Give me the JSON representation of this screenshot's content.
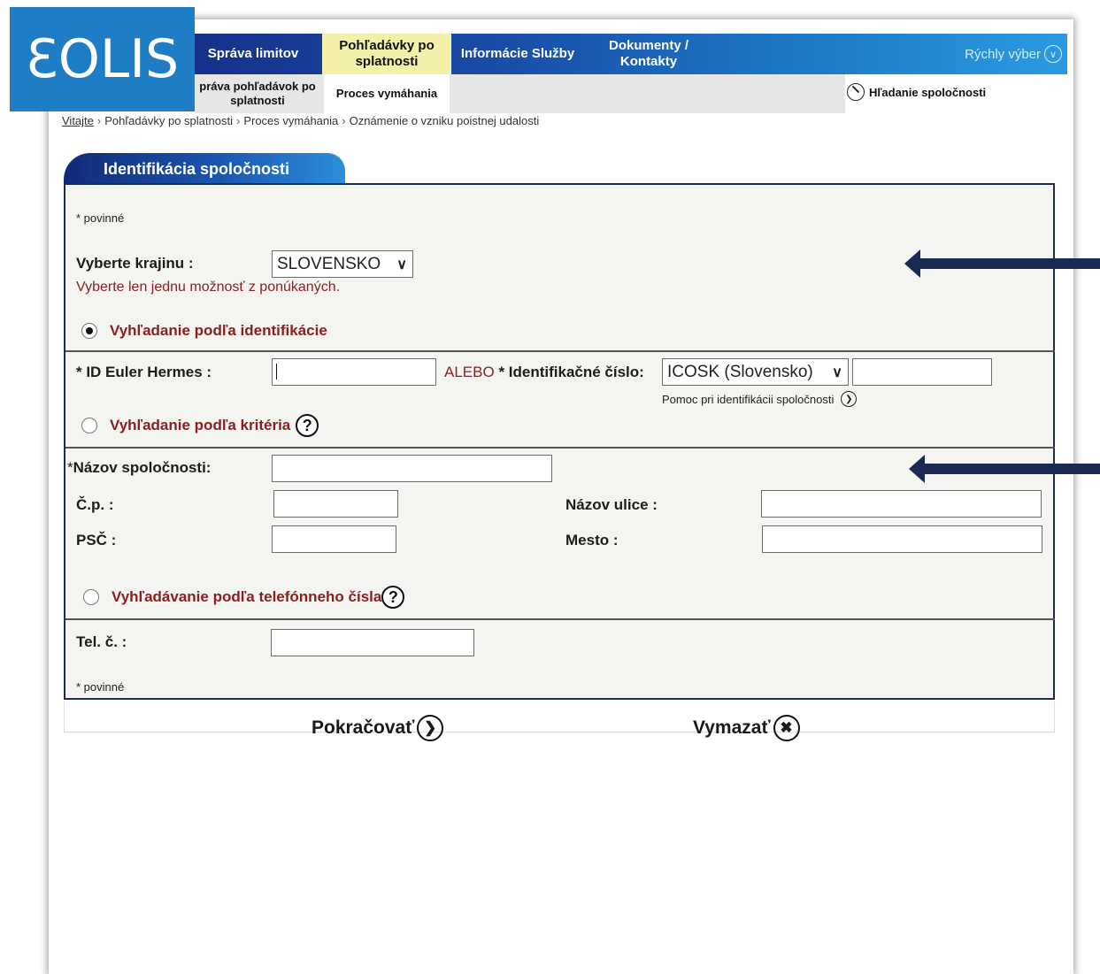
{
  "logo": {
    "text": "ƐOLIS"
  },
  "nav": {
    "items": [
      {
        "label": "Správa limitov"
      },
      {
        "label": "Pohľadávky po splatnosti"
      },
      {
        "label": "Informácie Služby"
      },
      {
        "label": "Dokumenty / Kontakty"
      }
    ],
    "quick": "Rýchly výber"
  },
  "subnav": {
    "items": [
      {
        "label": "práva pohľadávok po splatnosti"
      },
      {
        "label": "Proces vymáhania"
      }
    ],
    "company_search": "Hľadanie  spoločnosti"
  },
  "breadcrumb": {
    "home": "Vitajte",
    "items": [
      "Pohľadávky po splatnosti",
      "Proces vymáhania",
      "Oznámenie o vzniku poistnej udalosti"
    ]
  },
  "section": {
    "title": "Identifikácia spoločnosti"
  },
  "form": {
    "required_note": "* povinné",
    "country_label": "Vyberte krajinu :",
    "country_value": "SLOVENSKO",
    "country_hint": "Vyberte len jednu možnosť z ponúkaných.",
    "radio_identification": "Vyhľadanie podľa identifikácie",
    "id_label": "* ID Euler Hermes :",
    "or_label": "ALEBO",
    "idnum_label": "* Identifikačné číslo:",
    "idnum_type": "ICOSK (Slovensko)",
    "help_identification": "Pomoc pri identifikácii spoločnosti",
    "radio_criteria": "Vyhľadanie podľa kritéria",
    "company_name_label": "Názov spoločnosti:",
    "house_no_label": "Č.p. :",
    "street_label": "Názov ulice :",
    "zip_label": "PSČ :",
    "city_label": "Mesto :",
    "radio_phone": "Vyhľadávanie podľa telefónneho čísla",
    "phone_label": "Tel. č. :"
  },
  "actions": {
    "continue": "Pokračovať",
    "clear": "Vymazať"
  },
  "colors": {
    "nav_start": "#15318a",
    "nav_end": "#2a9be0",
    "active_tab": "#f2f0a9",
    "logo_bg": "#1e7dc4",
    "accent_red": "#8a1f1f",
    "arrow": "#1b2a52"
  }
}
